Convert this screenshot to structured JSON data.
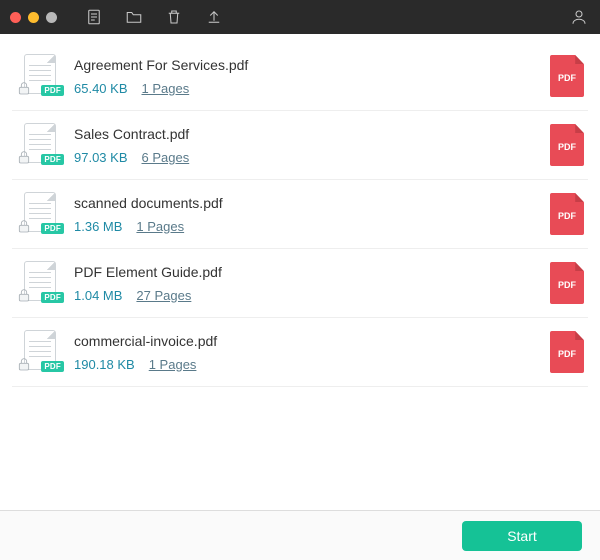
{
  "toolbar": {
    "doc_icon": "document",
    "folder_icon": "folder",
    "trash_icon": "trash",
    "upload_icon": "upload",
    "user_icon": "user"
  },
  "pdf_badge": "PDF",
  "out_badge": "PDF",
  "files": [
    {
      "name": "Agreement For Services.pdf",
      "size": "65.40 KB",
      "pages": "1 Pages"
    },
    {
      "name": "Sales Contract.pdf",
      "size": "97.03 KB",
      "pages": "6 Pages"
    },
    {
      "name": "scanned documents.pdf",
      "size": "1.36 MB",
      "pages": "1 Pages"
    },
    {
      "name": "PDF Element Guide.pdf",
      "size": "1.04 MB",
      "pages": "27 Pages"
    },
    {
      "name": "commercial-invoice.pdf",
      "size": "190.18 KB",
      "pages": "1 Pages"
    }
  ],
  "footer": {
    "start_label": "Start"
  },
  "colors": {
    "accent": "#15c296",
    "link": "#1f8aa5",
    "output": "#e84b56"
  }
}
